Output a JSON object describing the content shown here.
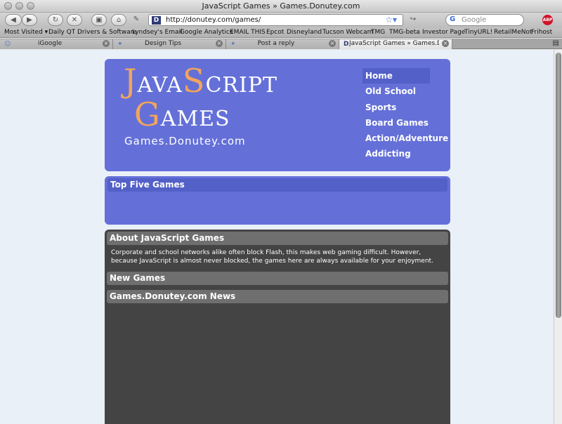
{
  "window": {
    "title": "JavaScript Games » Games.Donutey.com"
  },
  "toolbar": {
    "url": "http://donutey.com/games/",
    "search_placeholder": "Google",
    "abp_label": "ABP"
  },
  "bookmarks": [
    "Most Visited ▾",
    "Daily QT",
    "Drivers & Software",
    "Lyndsey's Email",
    "Google Analytics",
    "EMAIL THIS",
    "Epcot",
    "Disneyland",
    "Tucson Webcam",
    "TMG",
    "TMG-beta",
    "Investor Page",
    "TinyURL!",
    "RetailMeNot",
    "Frihost"
  ],
  "tabs": [
    {
      "label": "iGoogle",
      "active": false
    },
    {
      "label": "Design Tips",
      "active": false
    },
    {
      "label": "Post a reply",
      "active": false
    },
    {
      "label": "JavaScript Games » Games.Don...",
      "active": true
    }
  ],
  "site": {
    "logo_line1_a": "J",
    "logo_line1_b": "AVA",
    "logo_line1_c": "S",
    "logo_line1_d": "CRIPT",
    "logo_line2_a": "G",
    "logo_line2_b": "AMES",
    "domain": "Games.Donutey.com",
    "nav": [
      "Home",
      "Old School",
      "Sports",
      "Board Games",
      "Action/Adventure",
      "Addicting"
    ],
    "top_five_title": "Top Five Games",
    "about_title": "About JavaScript Games",
    "about_text": "Corporate and school networks alike often block Flash, this makes web gaming difficult. However, because JavaScript is almost never blocked, the games here are always available for your enjoyment.",
    "new_games_title": "New Games",
    "news_title": "Games.Donutey.com News"
  },
  "colors": {
    "header_bg": "#6470d8",
    "accent": "#f2a55b",
    "dark_bg": "#444444"
  }
}
